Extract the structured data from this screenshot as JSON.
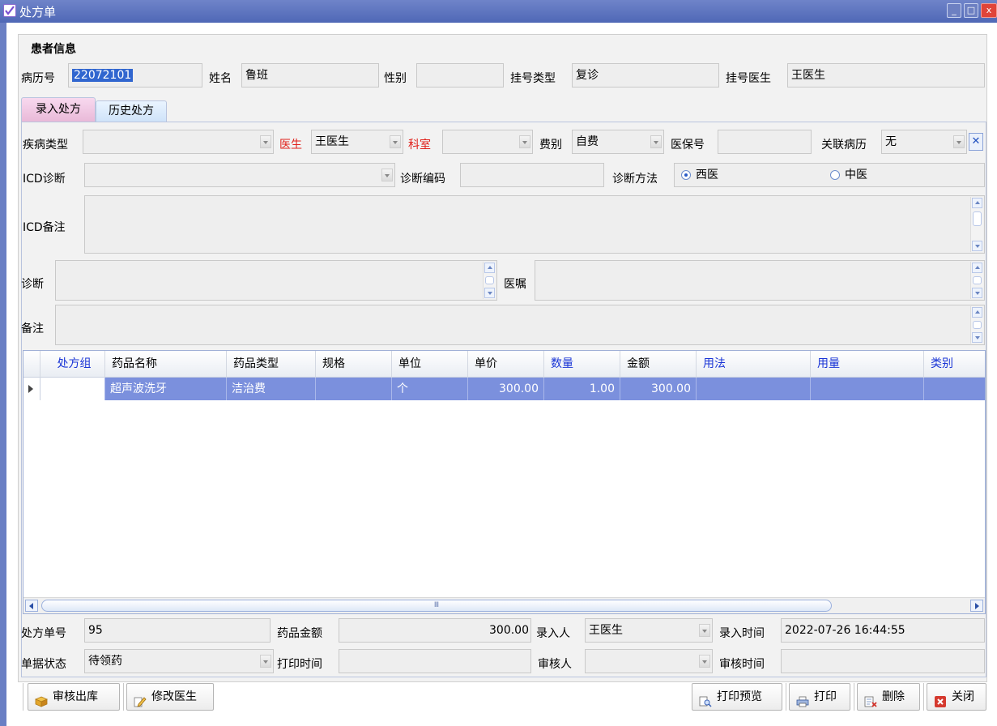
{
  "window": {
    "title": "处方单",
    "min": "_",
    "max": "□",
    "close": "x"
  },
  "patient": {
    "section_title": "患者信息",
    "record_no_label": "病历号",
    "record_no": "22072101",
    "name_label": "姓名",
    "name": "鲁班",
    "sex_label": "性别",
    "sex": "",
    "reg_type_label": "挂号类型",
    "reg_type": "复诊",
    "reg_doctor_label": "挂号医生",
    "reg_doctor": "王医生"
  },
  "tabs": [
    {
      "label": "录入处方"
    },
    {
      "label": "历史处方"
    }
  ],
  "form": {
    "disease_type_label": "疾病类型",
    "disease_type": "",
    "doctor_label": "医生",
    "doctor": "王医生",
    "dept_label": "科室",
    "dept": "",
    "fee_label": "费别",
    "fee": "自费",
    "insurance_label": "医保号",
    "insurance": "",
    "related_label": "关联病历",
    "related": "无",
    "icd_diag_label": "ICD诊断",
    "icd_diag": "",
    "diag_code_label": "诊断编码",
    "diag_code": "",
    "diag_method_label": "诊断方法",
    "method_options": [
      {
        "label": "西医",
        "checked": true
      },
      {
        "label": "中医",
        "checked": false
      }
    ],
    "icd_note_label": "ICD备注",
    "diagnosis_label": "诊断",
    "advice_label": "医嘱",
    "remark_label": "备注"
  },
  "grid": {
    "columns": [
      "处方组",
      "药品名称",
      "药品类型",
      "规格",
      "单位",
      "单价",
      "数量",
      "金额",
      "用法",
      "用量",
      "类别"
    ],
    "blue_columns": [
      "处方组",
      "数量",
      "用法",
      "用量",
      "类别"
    ],
    "rows": [
      {
        "group": "",
        "name": "超声波洗牙",
        "type": "洁治费",
        "spec": "",
        "unit": "个",
        "price": "300.00",
        "qty": "1.00",
        "amount": "300.00",
        "usage": "",
        "dosage": "",
        "category": ""
      }
    ],
    "scroll_thumb": "Ⅲ"
  },
  "footer": {
    "order_no_label": "处方单号",
    "order_no": "95",
    "drug_amount_label": "药品金额",
    "drug_amount": "300.00",
    "entry_user_label": "录入人",
    "entry_user": "王医生",
    "entry_time_label": "录入时间",
    "entry_time": "2022-07-26 16:44:55",
    "status_label": "单据状态",
    "status": "待领药",
    "print_time_label": "打印时间",
    "print_time": "",
    "reviewer_label": "审核人",
    "reviewer": "",
    "review_time_label": "审核时间",
    "review_time": ""
  },
  "buttons": {
    "audit": "审核出库",
    "change_doctor": "修改医生",
    "preview": "打印预览",
    "print": "打印",
    "delete": "删除",
    "close": "关闭"
  },
  "colors": {
    "titlebar": "#5a70bd",
    "selected_row": "#7b90dd",
    "header_blue": "#1a35d6",
    "required_red": "#e0201a"
  }
}
